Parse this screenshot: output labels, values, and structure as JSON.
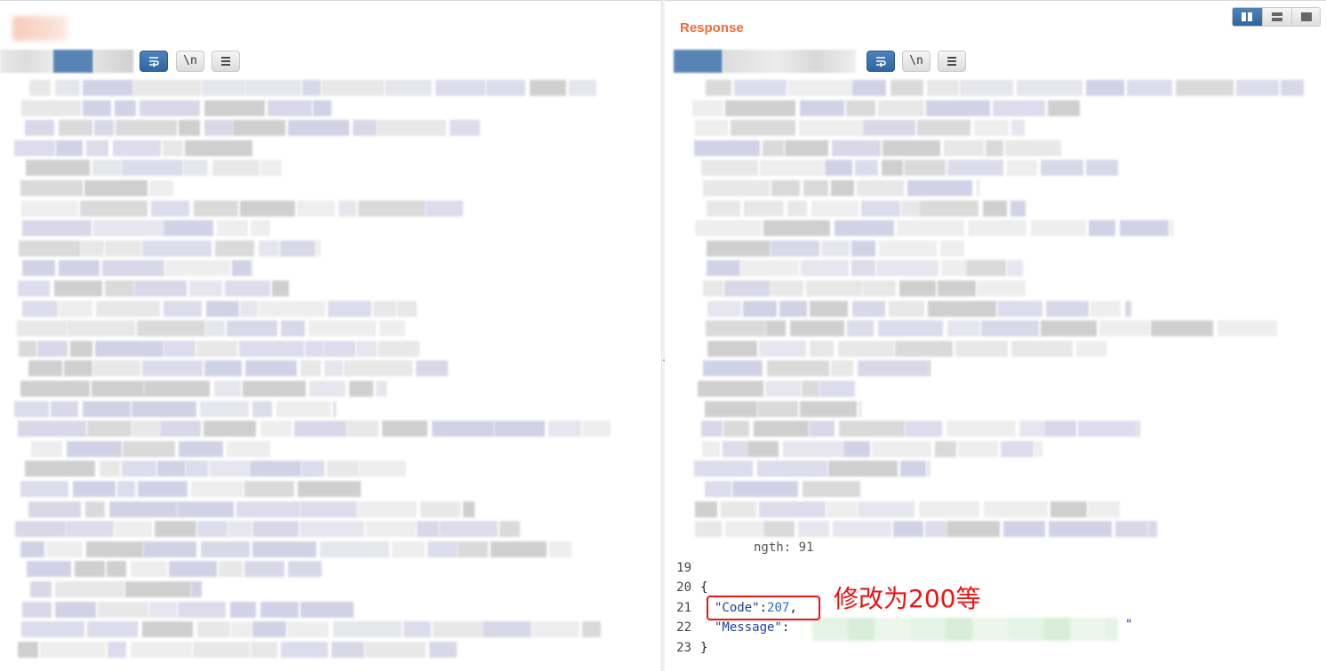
{
  "response_pane": {
    "title": "Response",
    "line_numbers": [
      "19",
      "20",
      "21",
      "22",
      "23"
    ],
    "partial_line_text": "ngth: 91",
    "code_lines": {
      "open_brace": "{",
      "code_key": "\"Code\"",
      "code_value": "207",
      "message_key": "\"Message\"",
      "message_colon": ":",
      "message_close_quote": "\"",
      "close_brace": "}"
    },
    "annotation": "修改为200等"
  },
  "toolbar": {
    "newline_button_label": "\\n",
    "icons": [
      "wrap-lines-icon",
      "menu-icon"
    ]
  },
  "view_toggle": {
    "options": [
      "split-view-icon",
      "horizontal-view-icon",
      "single-view-icon"
    ],
    "selected": "split-view-icon"
  },
  "colors": {
    "accent_orange": "#f26b3a",
    "active_blue": "#2f66a1",
    "highlight_red": "#ee1111"
  }
}
